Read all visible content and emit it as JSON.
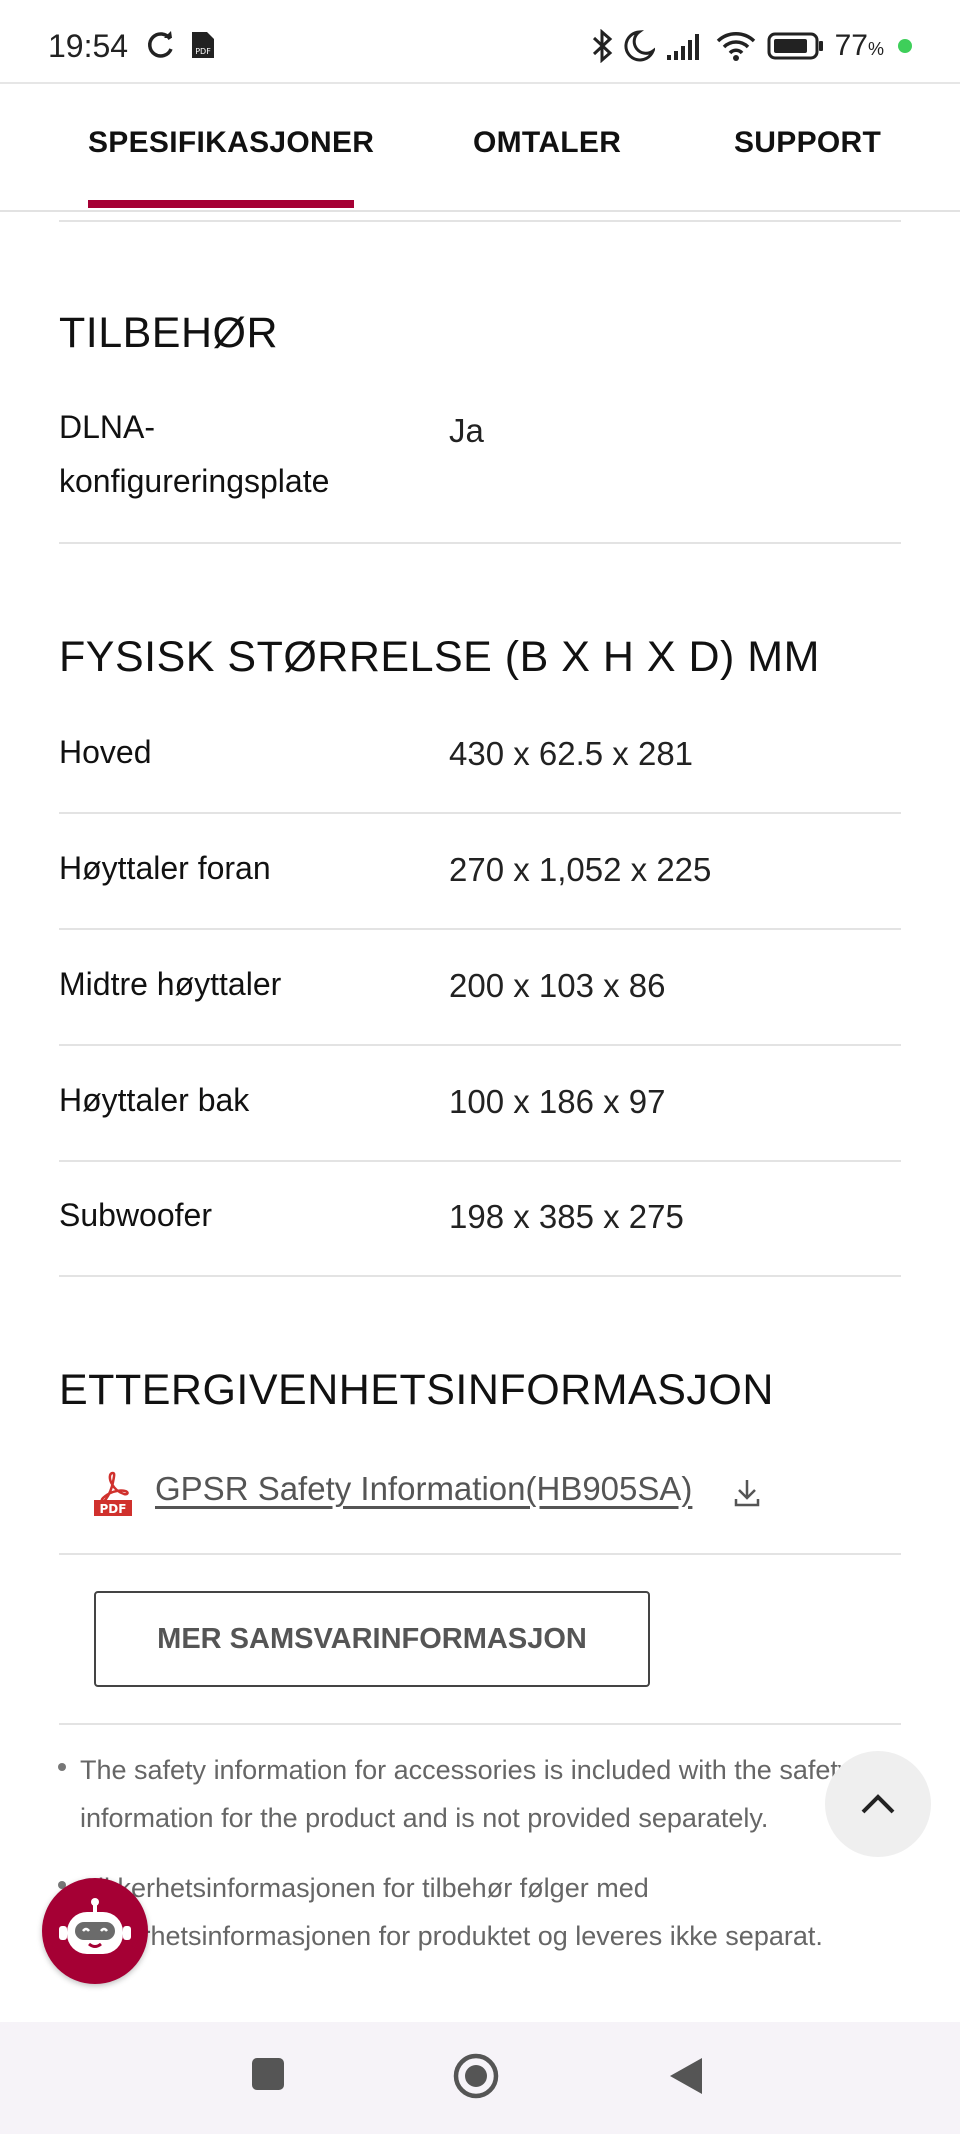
{
  "status_bar": {
    "time": "19:54",
    "battery_percent": "77",
    "battery_suffix": "%",
    "icons": [
      "sync-icon",
      "pdf-notification-icon",
      "bluetooth-icon",
      "do-not-disturb-icon",
      "signal-icon",
      "wifi-icon",
      "battery-icon"
    ]
  },
  "tabs": [
    {
      "label": "SPESIFIKASJONER",
      "active": true
    },
    {
      "label": "OMTALER",
      "active": false
    },
    {
      "label": "SUPPORT",
      "active": false
    }
  ],
  "accent_color": "#a50034",
  "accessories": {
    "title": "TILBEHØR",
    "rows": [
      {
        "label_line1": "DLNA-",
        "label_line2": "konfigureringsplate",
        "value": "Ja"
      }
    ]
  },
  "dimensions": {
    "title": "FYSISK STØRRELSE (B X H X D) MM",
    "rows": [
      {
        "label": "Hoved",
        "value": "430 x 62.5 x 281"
      },
      {
        "label": "Høyttaler foran",
        "value": "270 x 1,052 x 225"
      },
      {
        "label": "Midtre høyttaler",
        "value": "200 x 103 x 86"
      },
      {
        "label": "Høyttaler bak",
        "value": "100 x 186 x 97"
      },
      {
        "label": "Subwoofer",
        "value": "198 x 385 x 275"
      }
    ]
  },
  "compliance": {
    "title": "ETTERGIVENHETSINFORMASJON",
    "document_link": "GPSR Safety Information(HB905SA)",
    "more_button": "MER SAMSVARINFORMASJON",
    "notes": [
      {
        "line1": "The safety information for accessories is included with the safety",
        "line2": "information for the product and is not provided separately."
      },
      {
        "line1": "Sikkerhetsinformasjonen for tilbehør følger med",
        "line2": "sikkerhetsinformasjonen for produktet og leveres ikke separat."
      }
    ]
  }
}
